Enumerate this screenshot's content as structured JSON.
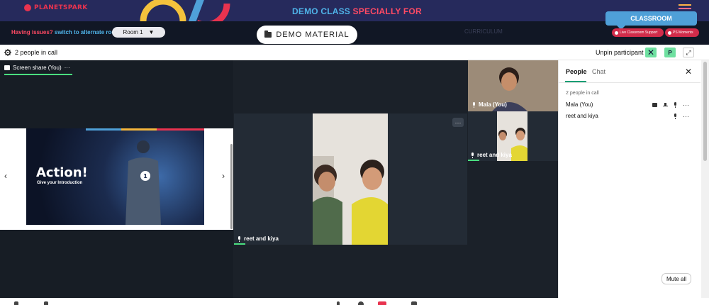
{
  "banner": {
    "logo_text": "PLANETSPARK",
    "demo_title_part1": "DEMO CLASS ",
    "demo_title_part2": "SPECIALLY FOR"
  },
  "navbar": {
    "issues_question": "Having issues?",
    "issues_link": " switch to alternate room",
    "room_selected": "Room 1",
    "demo_material_label": "DEMO MATERIAL",
    "curriculum_label": "CURRICULUM",
    "classroom_tab": "CLASSROOM",
    "support_button": "Live Classroom Support",
    "moments_button": "PS Moments"
  },
  "meet_header": {
    "people_count": "2 people in call",
    "unpin_label": "Unpin participant",
    "avatar_initial": "P"
  },
  "tiles": {
    "screen_share_label": "Screen share (You)",
    "slide_title": "Action!",
    "slide_subtitle": "Give your Introduction",
    "slide_number": "1",
    "main_label": "reet and kiya",
    "mala_label": "Mala (You)",
    "small_label": "reet and kiya"
  },
  "side_panel": {
    "tab_people": "People",
    "tab_chat": "Chat",
    "in_call": "2 people in call",
    "people": [
      {
        "name": "Mala (You)"
      },
      {
        "name": "reet and kiya"
      }
    ],
    "mute_all": "Mute all"
  },
  "colors": {
    "banner_bg": "#262a5c",
    "accent_red": "#ff4a64",
    "accent_blue": "#4fb3e8",
    "meet_green": "#6fe0a0"
  }
}
